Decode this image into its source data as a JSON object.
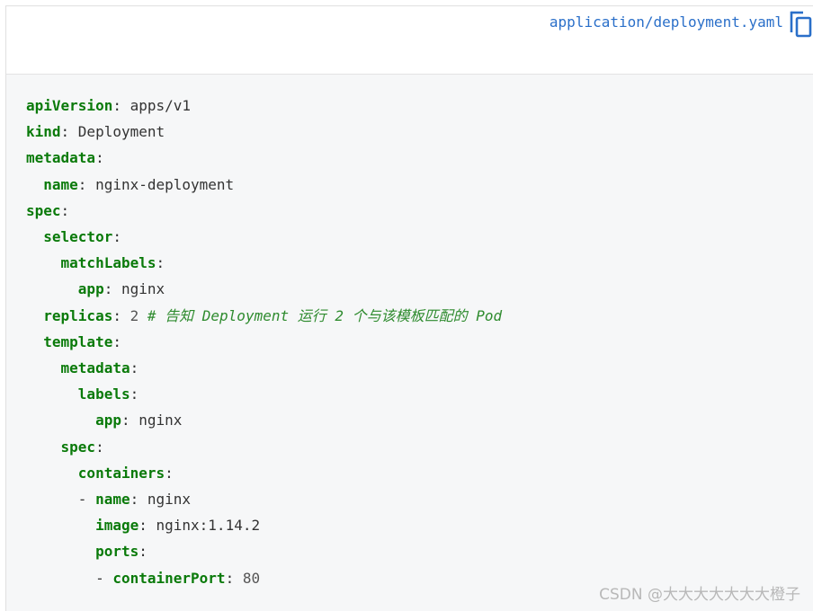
{
  "header": {
    "filename": "application/deployment.yaml",
    "copy_icon": "copy-icon"
  },
  "code": {
    "lines": [
      {
        "indent": "",
        "key": "apiVersion",
        "sep": ": ",
        "value": "apps/v1",
        "comment": ""
      },
      {
        "indent": "",
        "key": "kind",
        "sep": ": ",
        "value": "Deployment",
        "comment": ""
      },
      {
        "indent": "",
        "key": "metadata",
        "sep": ":",
        "value": "",
        "comment": ""
      },
      {
        "indent": "  ",
        "key": "name",
        "sep": ": ",
        "value": "nginx-deployment",
        "comment": ""
      },
      {
        "indent": "",
        "key": "spec",
        "sep": ":",
        "value": "",
        "comment": ""
      },
      {
        "indent": "  ",
        "key": "selector",
        "sep": ":",
        "value": "",
        "comment": ""
      },
      {
        "indent": "    ",
        "key": "matchLabels",
        "sep": ":",
        "value": "",
        "comment": ""
      },
      {
        "indent": "      ",
        "key": "app",
        "sep": ": ",
        "value": "nginx",
        "comment": ""
      },
      {
        "indent": "  ",
        "key": "replicas",
        "sep": ": ",
        "value": "2",
        "comment": "# 告知 Deployment 运行 2 个与该模板匹配的 Pod"
      },
      {
        "indent": "  ",
        "key": "template",
        "sep": ":",
        "value": "",
        "comment": ""
      },
      {
        "indent": "    ",
        "key": "metadata",
        "sep": ":",
        "value": "",
        "comment": ""
      },
      {
        "indent": "      ",
        "key": "labels",
        "sep": ":",
        "value": "",
        "comment": ""
      },
      {
        "indent": "        ",
        "key": "app",
        "sep": ": ",
        "value": "nginx",
        "comment": ""
      },
      {
        "indent": "    ",
        "key": "spec",
        "sep": ":",
        "value": "",
        "comment": ""
      },
      {
        "indent": "      ",
        "key": "containers",
        "sep": ":",
        "value": "",
        "comment": ""
      },
      {
        "indent": "      - ",
        "key": "name",
        "sep": ": ",
        "value": "nginx",
        "comment": ""
      },
      {
        "indent": "        ",
        "key": "image",
        "sep": ": ",
        "value": "nginx:1.14.2",
        "comment": ""
      },
      {
        "indent": "        ",
        "key": "ports",
        "sep": ":",
        "value": "",
        "comment": ""
      },
      {
        "indent": "        - ",
        "key": "containerPort",
        "sep": ": ",
        "value": "80",
        "comment": ""
      }
    ]
  },
  "watermark": "CSDN @大大大大大大大橙子",
  "colors": {
    "key": "#0a7a0a",
    "comment": "#2e8b2e",
    "filename": "#2a6fc9",
    "code_bg": "#f6f7f8"
  }
}
